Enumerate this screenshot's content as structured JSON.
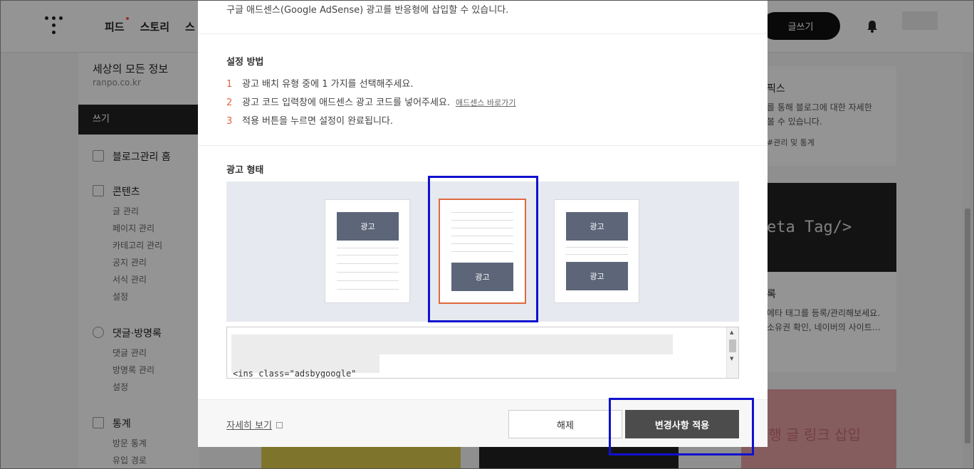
{
  "header": {
    "nav": [
      "피드",
      "스토리",
      "스"
    ],
    "write_label": "글쓰기"
  },
  "sidebar": {
    "blog_title": "세상의 모든 정보",
    "blog_url": "ranpo.co.kr",
    "write_label": "쓰기",
    "home_label": "블로그관리 홈",
    "content_label": "콘텐츠",
    "content_items": [
      "글 관리",
      "페이지 관리",
      "카테고리 관리",
      "공지 관리",
      "서식 관리",
      "설정"
    ],
    "comments_label": "댓글·방명록",
    "comments_items": [
      "댓글 관리",
      "방명록 관리",
      "설정"
    ],
    "stats_label": "통계",
    "stats_items": [
      "방문 통계",
      "유입 경로"
    ]
  },
  "right": {
    "card1_title": "픽스",
    "card1_text1": "를 통해 블로그에 대한 자세한",
    "card1_text2": "볼 수 있습니다.",
    "card1_link": "#관리 및 통계",
    "dark_text": "eta Tag/>",
    "card2_title": "록",
    "card2_text1": "메타 태그를 등록/관리해보세요.",
    "card2_text2": "소유권 확인, 네이버의 사이트…",
    "pink_text": "관행 글 링크 삽입"
  },
  "modal": {
    "intro": "구글 애드센스(Google AdSense) 광고를 반응형에 삽입할 수 있습니다.",
    "setup_heading": "설정 방법",
    "steps": [
      {
        "num": "1",
        "text": "광고 배치 유형 중에 1 가지를 선택해주세요."
      },
      {
        "num": "2",
        "text": "광고 코드 입력창에 애드센스 광고 코드를 넣어주세요.",
        "link": "애드센스 바로가기"
      },
      {
        "num": "3",
        "text": "적용 버튼을 누르면 설정이 완료됩니다."
      }
    ],
    "adtype_heading": "광고 형태",
    "ad_label": "광고",
    "code_tail": "<ins class=\"adsbygoogle\"",
    "detail_link": "자세히 보기",
    "cancel_label": "해제",
    "apply_label": "변경사항 적용"
  }
}
